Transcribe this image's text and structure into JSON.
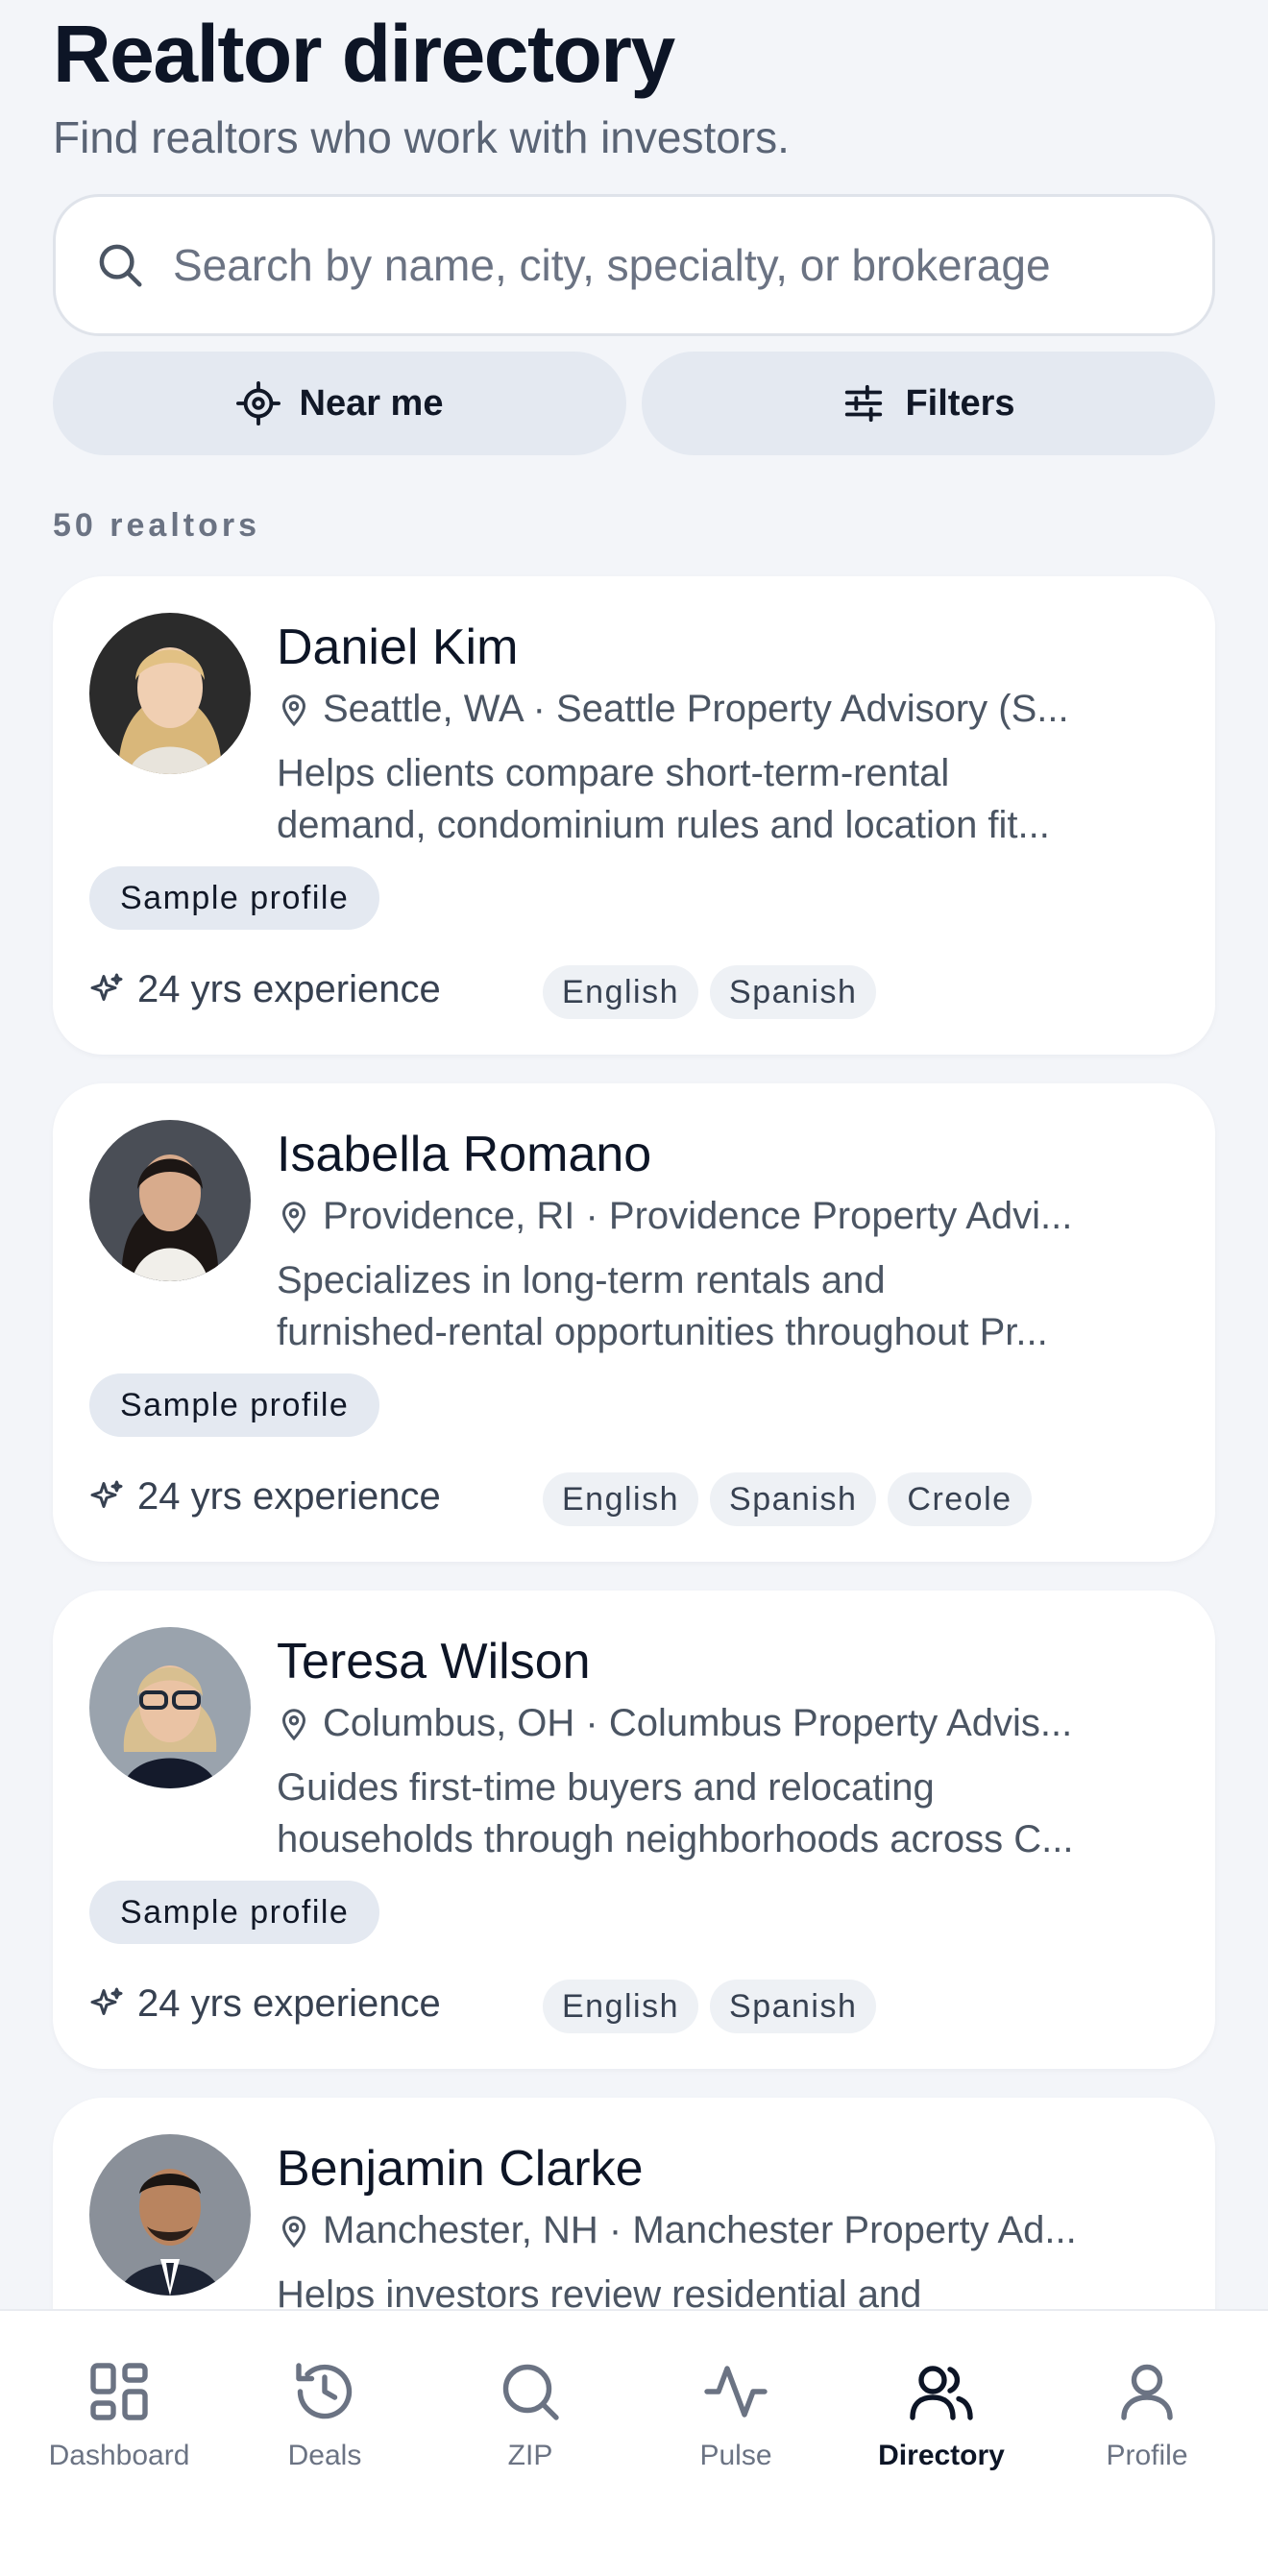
{
  "header": {
    "title": "Realtor directory",
    "subtitle": "Find realtors who work with investors."
  },
  "search": {
    "placeholder": "Search by name, city, specialty, or brokerage",
    "value": ""
  },
  "actions": {
    "near_me": "Near me",
    "filters": "Filters"
  },
  "results_count": "50 realtors",
  "realtors": [
    {
      "name": "Daniel Kim",
      "location": "Seattle, WA · Seattle Property Advisory (S...",
      "description_lines": [
        "Helps clients compare short-term-rental",
        "demand, condominium rules and location fit..."
      ],
      "badge": "Sample profile",
      "experience": "24 yrs experience",
      "languages": [
        "English",
        "Spanish"
      ]
    },
    {
      "name": "Isabella Romano",
      "location": "Providence, RI · Providence Property Advi...",
      "description_lines": [
        "Specializes in long-term rentals and",
        "furnished-rental opportunities throughout Pr..."
      ],
      "badge": "Sample profile",
      "experience": "24 yrs experience",
      "languages": [
        "English",
        "Spanish",
        "Creole"
      ]
    },
    {
      "name": "Teresa Wilson",
      "location": "Columbus, OH · Columbus Property Advis...",
      "description_lines": [
        "Guides first-time buyers and relocating",
        "households through neighborhoods across C..."
      ],
      "badge": "Sample profile",
      "experience": "24 yrs experience",
      "languages": [
        "English",
        "Spanish"
      ]
    },
    {
      "name": "Benjamin Clarke",
      "location": "Manchester, NH · Manchester Property Ad...",
      "description_lines": [
        "Helps investors review residential and",
        ""
      ],
      "badge": "",
      "experience": "",
      "languages": []
    }
  ],
  "tabbar": {
    "dashboard": "Dashboard",
    "deals": "Deals",
    "zip": "ZIP",
    "pulse": "Pulse",
    "directory": "Directory",
    "profile": "Profile",
    "active": "Directory"
  },
  "colors": {
    "background": "#f3f5f9",
    "card": "#ffffff",
    "pill": "#e4e9f1",
    "text_primary": "#0d1526",
    "text_secondary": "#4b5563"
  }
}
